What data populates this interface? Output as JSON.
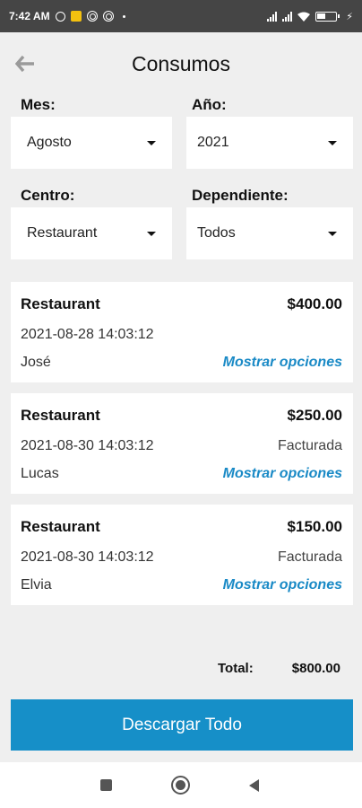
{
  "status_bar": {
    "time": "7:42 AM",
    "icons": [
      "alarm-icon",
      "notification-icon",
      "sync-icon",
      "sync-icon",
      "dot-icon",
      "signal-icon",
      "signal-icon",
      "wifi-icon",
      "battery-icon",
      "charging-icon"
    ]
  },
  "header": {
    "title": "Consumos",
    "back_icon": "arrow-left-icon"
  },
  "filters": {
    "mes": {
      "label": "Mes:",
      "value": "Agosto"
    },
    "anio": {
      "label": "Año:",
      "value": "2021"
    },
    "centro": {
      "label": "Centro:",
      "value": "Restaurant"
    },
    "dependiente": {
      "label": "Dependiente:",
      "value": "Todos"
    }
  },
  "consumos": [
    {
      "center": "Restaurant",
      "amount": "$400.00",
      "datetime": "2021-08-28 14:03:12",
      "status": "",
      "person": "José",
      "link": "Mostrar opciones"
    },
    {
      "center": "Restaurant",
      "amount": "$250.00",
      "datetime": "2021-08-30 14:03:12",
      "status": "Facturada",
      "person": "Lucas",
      "link": "Mostrar opciones"
    },
    {
      "center": "Restaurant",
      "amount": "$150.00",
      "datetime": "2021-08-30 14:03:12",
      "status": "Facturada",
      "person": "Elvia",
      "link": "Mostrar opciones"
    }
  ],
  "total": {
    "label": "Total:",
    "value": "$800.00"
  },
  "download_button": "Descargar Todo",
  "colors": {
    "accent": "#168fc8",
    "link": "#1a8ac6",
    "background": "#efefef",
    "status_bar": "#454545"
  },
  "nav_bar": {
    "icons": [
      "recents-icon",
      "home-icon",
      "back-icon"
    ]
  }
}
